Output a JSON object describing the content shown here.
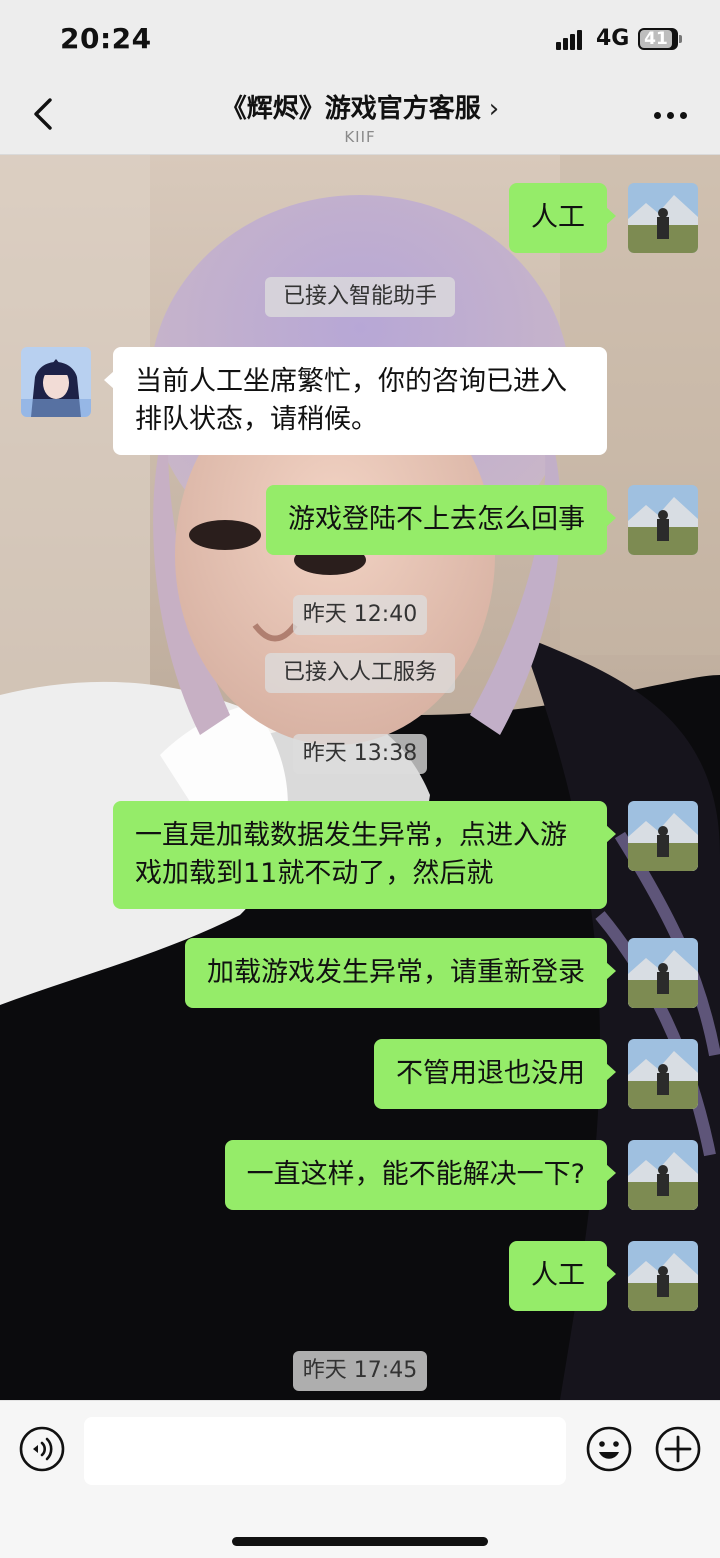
{
  "status_bar": {
    "time": "20:24",
    "network": "4G",
    "battery": "41"
  },
  "header": {
    "title": "《辉烬》游戏官方客服",
    "chevron": "›",
    "subtitle": "KIIF"
  },
  "icons": {
    "back": "chevron-left-icon",
    "more": "more-icon",
    "voice": "voice-icon",
    "emoji": "emoji-icon",
    "add": "plus-icon"
  },
  "colors": {
    "my_bubble": "#95ec69",
    "their_bubble": "#ffffff",
    "background": "#ededed"
  },
  "messages": [
    {
      "from": "me",
      "text": "人工"
    },
    {
      "system": "已接入智能助手"
    },
    {
      "from": "them",
      "text": "当前人工坐席繁忙，你的咨询已进入排队状态，请稍候。"
    },
    {
      "from": "me",
      "text": "游戏登陆不上去怎么回事"
    },
    {
      "timestamp": "昨天 12:40"
    },
    {
      "system": "已接入人工服务"
    },
    {
      "timestamp": "昨天 13:38"
    },
    {
      "from": "me",
      "text": "一直是加载数据发生异常，点进入游戏加载到11就不动了，然后就"
    },
    {
      "from": "me",
      "text": "加载游戏发生异常，请重新登录"
    },
    {
      "from": "me",
      "text": "不管用退也没用"
    },
    {
      "from": "me",
      "text": "一直这样，能不能解决一下?"
    },
    {
      "from": "me",
      "text": "人工"
    },
    {
      "timestamp": "昨天 17:45"
    }
  ],
  "input": {
    "value": ""
  }
}
